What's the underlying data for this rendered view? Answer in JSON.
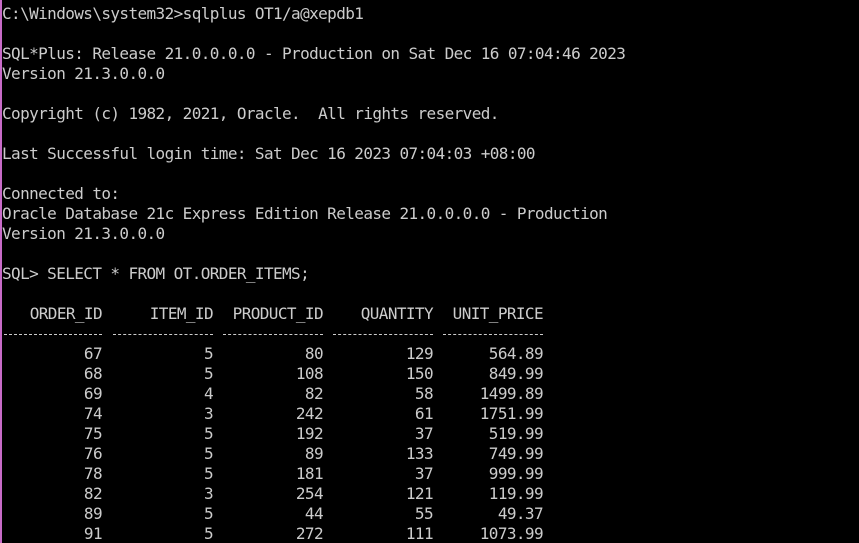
{
  "terminal": {
    "command_line": "C:\\Windows\\system32>sqlplus OT1/a@xepdb1",
    "banner_line1": "SQL*Plus: Release 21.0.0.0.0 - Production on Sat Dec 16 07:04:46 2023",
    "banner_line2": "Version 21.3.0.0.0",
    "copyright": "Copyright (c) 1982, 2021, Oracle.  All rights reserved.",
    "last_login": "Last Successful login time: Sat Dec 16 2023 07:04:03 +08:00",
    "connected_to": "Connected to:",
    "db_line1": "Oracle Database 21c Express Edition Release 21.0.0.0.0 - Production",
    "db_line2": "Version 21.3.0.0.0",
    "sql_prompt": "SQL> SELECT * FROM OT.ORDER_ITEMS;"
  },
  "result": {
    "columns": [
      "ORDER_ID",
      "ITEM_ID",
      "PRODUCT_ID",
      "QUANTITY",
      "UNIT_PRICE"
    ],
    "rows": [
      [
        "67",
        "5",
        "80",
        "129",
        "564.89"
      ],
      [
        "68",
        "5",
        "108",
        "150",
        "849.99"
      ],
      [
        "69",
        "4",
        "82",
        "58",
        "1499.89"
      ],
      [
        "74",
        "3",
        "242",
        "61",
        "1751.99"
      ],
      [
        "75",
        "5",
        "192",
        "37",
        "519.99"
      ],
      [
        "76",
        "5",
        "89",
        "133",
        "749.99"
      ],
      [
        "78",
        "5",
        "181",
        "37",
        "999.99"
      ],
      [
        "82",
        "3",
        "254",
        "121",
        "119.99"
      ],
      [
        "89",
        "5",
        "44",
        "55",
        "49.37"
      ],
      [
        "91",
        "5",
        "272",
        "111",
        "1073.99"
      ]
    ]
  },
  "colors": {
    "background": "#000000",
    "text": "#cccccc",
    "left_border": "#c86bc8"
  }
}
